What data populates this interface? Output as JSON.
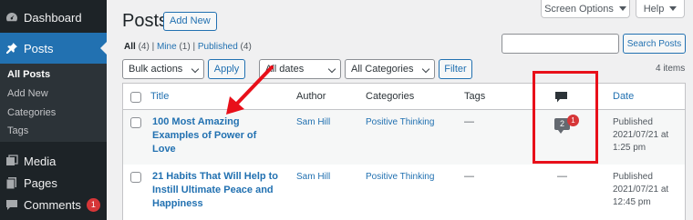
{
  "sidebar": {
    "dashboard": "Dashboard",
    "posts": "Posts",
    "submenu": [
      "All Posts",
      "Add New",
      "Categories",
      "Tags"
    ],
    "media": "Media",
    "pages": "Pages",
    "comments": "Comments",
    "comments_badge": "1"
  },
  "header": {
    "title": "Posts",
    "add_new": "Add New",
    "screen_options": "Screen Options",
    "help": "Help"
  },
  "views": {
    "all": "All",
    "all_count": "(4)",
    "mine": "Mine",
    "mine_count": "(1)",
    "published": "Published",
    "published_count": "(4)"
  },
  "search": {
    "button": "Search Posts",
    "value": ""
  },
  "filters": {
    "bulk_actions": "Bulk actions",
    "apply": "Apply",
    "dates": "All dates",
    "categories": "All Categories",
    "filter": "Filter",
    "items_count": "4 items"
  },
  "table": {
    "columns": {
      "title": "Title",
      "author": "Author",
      "categories": "Categories",
      "tags": "Tags",
      "date": "Date"
    },
    "rows": [
      {
        "title": "100 Most Amazing Examples of Power of Love",
        "author": "Sam Hill",
        "category": "Positive Thinking",
        "tags": "—",
        "comments_approved": "2",
        "comments_pending": "1",
        "date_status": "Published",
        "date": "2021/07/21 at",
        "time": "1:25 pm"
      },
      {
        "title": "21 Habits That Will Help to Instill Ultimate Peace and Happiness",
        "author": "Sam Hill",
        "category": "Positive Thinking",
        "tags": "—",
        "comments": "—",
        "date_status": "Published",
        "date": "2021/07/21 at",
        "time": "12:45 pm"
      }
    ]
  },
  "colors": {
    "sidebar_bg": "#1d2327",
    "accent": "#2271b1",
    "annotation": "#e8101a"
  }
}
